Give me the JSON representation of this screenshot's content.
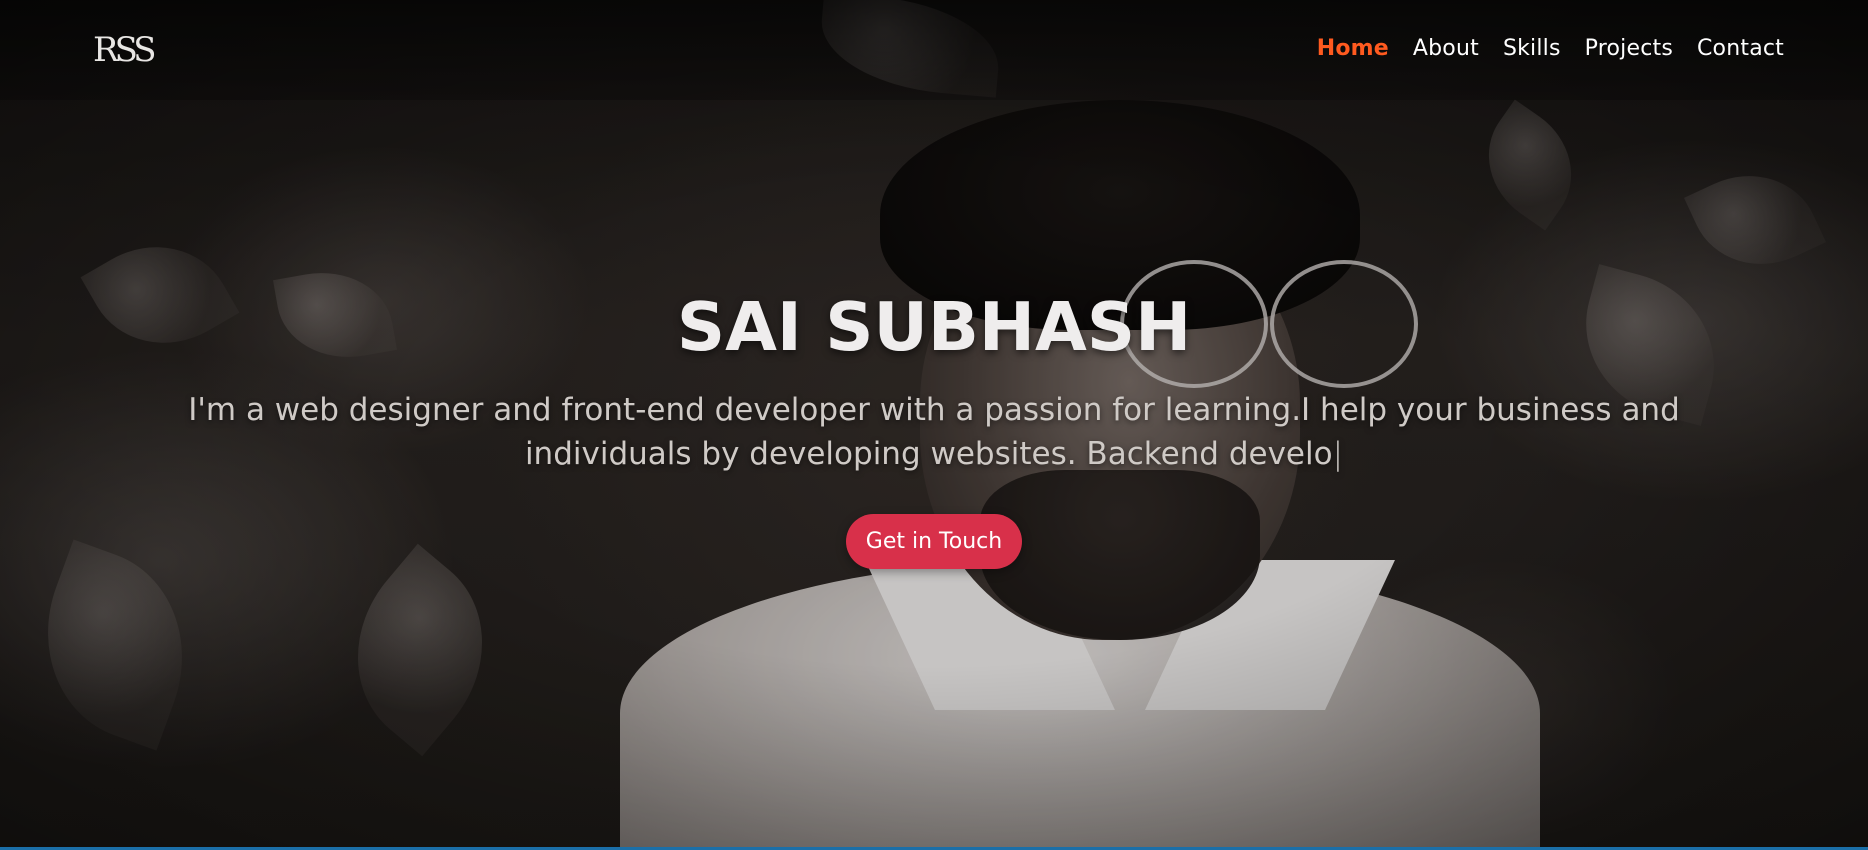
{
  "header": {
    "logo_text": "RSS",
    "nav": [
      {
        "label": "Home",
        "active": true
      },
      {
        "label": "About",
        "active": false
      },
      {
        "label": "Skills",
        "active": false
      },
      {
        "label": "Projects",
        "active": false
      },
      {
        "label": "Contact",
        "active": false
      }
    ]
  },
  "hero": {
    "name": "SAI SUBHASH",
    "tagline": "I'm a web designer and front-end developer with a passion for learning.I help your business and individuals by developing websites. Backend develo",
    "cursor": "|",
    "cta_label": "Get in Touch"
  },
  "colors": {
    "active_nav": "#ff5a1f",
    "cta_background": "#d8304a",
    "nav_text": "#ffffff",
    "heading_text": "#efeded"
  }
}
